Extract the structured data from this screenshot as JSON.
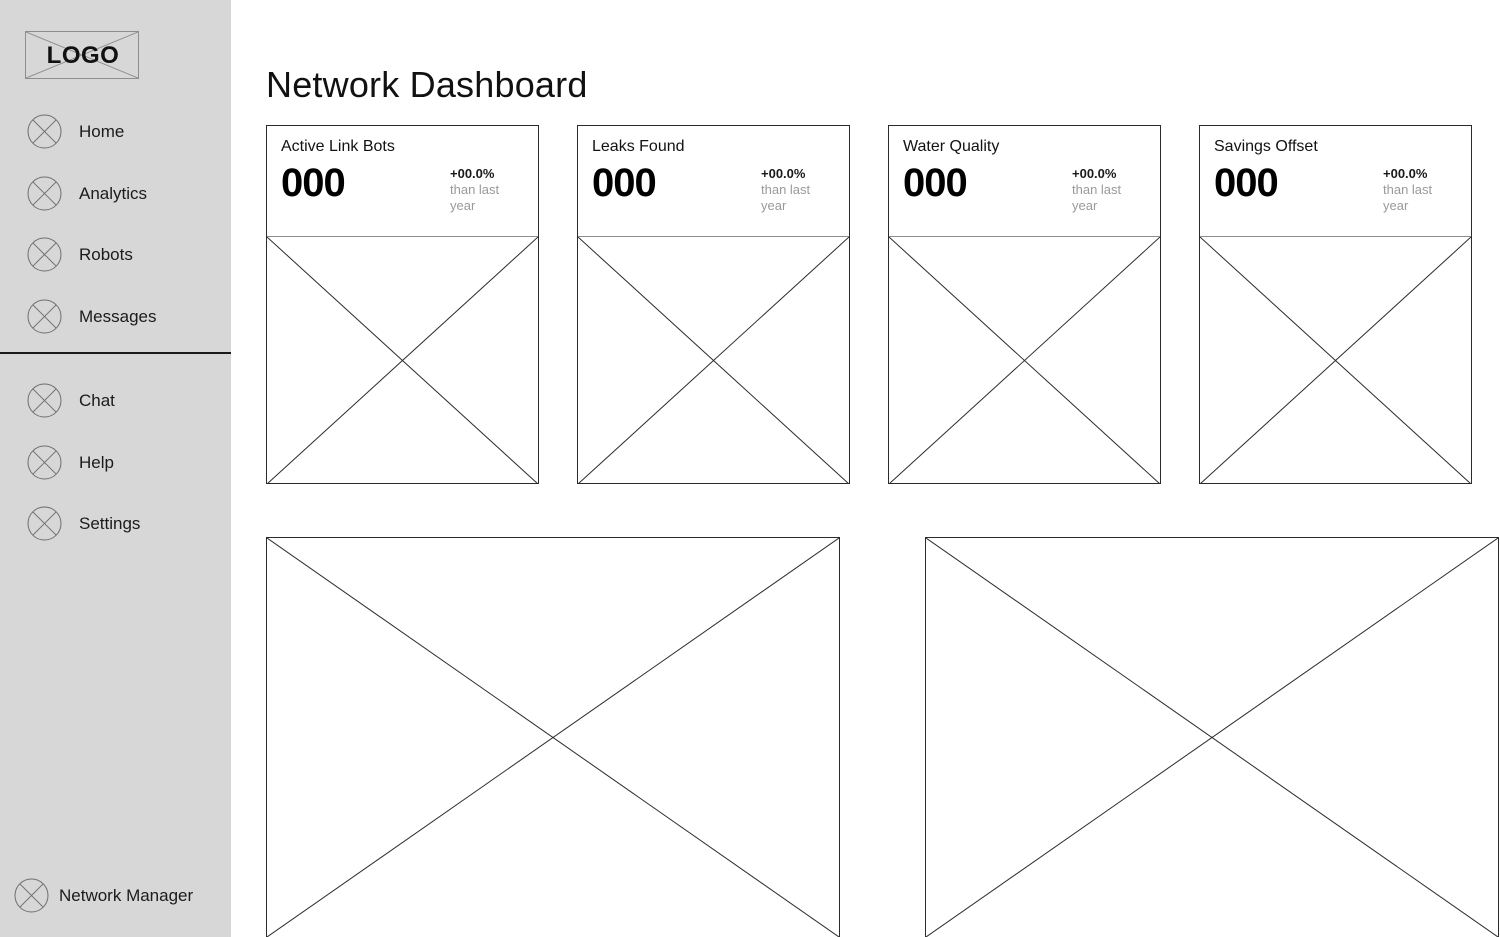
{
  "sidebar": {
    "logo": {
      "label": "LOGO",
      "icon": "image-placeholder-icon"
    },
    "primary_items": [
      {
        "label": "Home",
        "icon": "circle-cross-icon"
      },
      {
        "label": "Analytics",
        "icon": "circle-cross-icon"
      },
      {
        "label": "Robots",
        "icon": "circle-cross-icon"
      },
      {
        "label": "Messages",
        "icon": "circle-cross-icon"
      }
    ],
    "secondary_items": [
      {
        "label": "Chat",
        "icon": "circle-cross-icon"
      },
      {
        "label": "Help",
        "icon": "circle-cross-icon"
      },
      {
        "label": "Settings",
        "icon": "circle-cross-icon"
      }
    ],
    "footer": {
      "label": "Network Manager",
      "icon": "circle-cross-icon"
    },
    "background_color": "#d7d7d7",
    "divider_color": "#1a1a1a"
  },
  "header": {
    "title": "Network Dashboard"
  },
  "cards": [
    {
      "title": "Active Link Bots",
      "value": "000",
      "delta": "+00.0%",
      "delta_note": "than last year",
      "chart_placeholder": "image-placeholder-icon"
    },
    {
      "title": "Leaks Found",
      "value": "000",
      "delta": "+00.0%",
      "delta_note": "than last year",
      "chart_placeholder": "image-placeholder-icon"
    },
    {
      "title": "Water Quality",
      "value": "000",
      "delta": "+00.0%",
      "delta_note": "than last year",
      "chart_placeholder": "image-placeholder-icon"
    },
    {
      "title": "Savings Offset",
      "value": "000",
      "delta": "+00.0%",
      "delta_note": "than last year",
      "chart_placeholder": "image-placeholder-icon"
    }
  ],
  "panels": [
    {
      "placeholder": "image-placeholder-icon"
    },
    {
      "placeholder": "image-placeholder-icon"
    }
  ],
  "colors": {
    "text": "#111111",
    "muted_text": "#9a9a9a",
    "border": "#2b2b2b",
    "light_border": "#8d8d8d",
    "surface": "#ffffff",
    "sidebar": "#d7d7d7"
  }
}
